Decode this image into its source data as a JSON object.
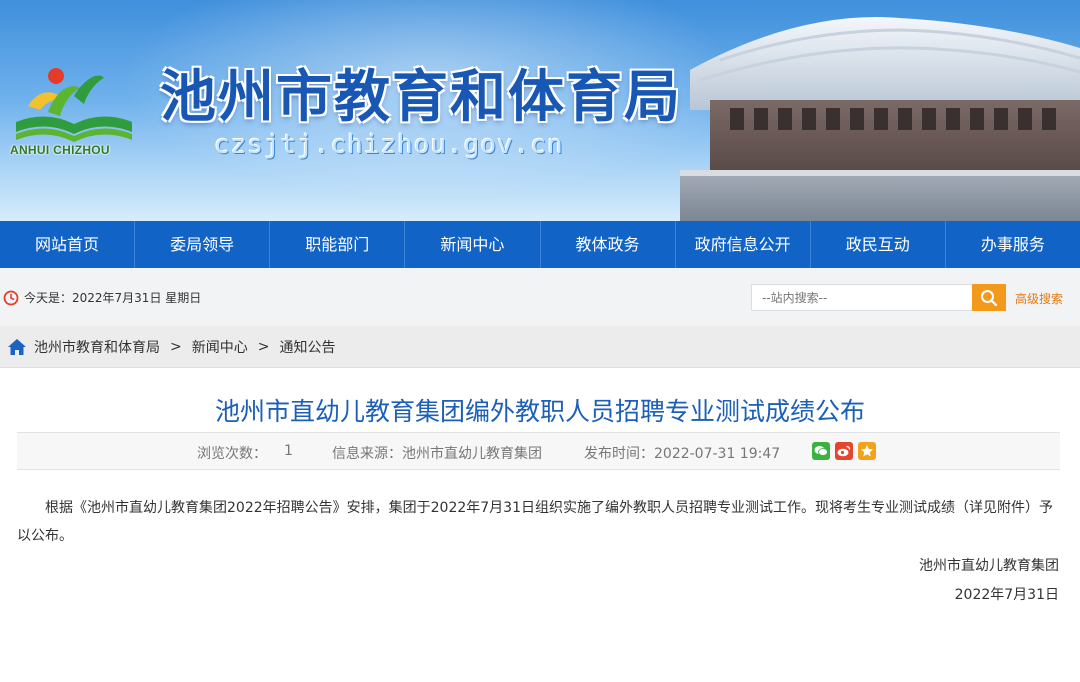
{
  "header": {
    "site_title": "池州市教育和体育局",
    "site_domain": "czsjtj.chizhou.gov.cn",
    "logo_text": "ANHUI CHIZHOU"
  },
  "nav": {
    "items": [
      "网站首页",
      "委局领导",
      "职能部门",
      "新闻中心",
      "教体政务",
      "政府信息公开",
      "政民互动",
      "办事服务"
    ]
  },
  "infobar": {
    "date_text": "今天是：2022年7月31日 星期日",
    "search_placeholder": "--站内搜索--",
    "advanced_search": "高级搜索"
  },
  "breadcrumb": {
    "items": [
      "池州市教育和体育局",
      "新闻中心",
      "通知公告"
    ],
    "separator": ">"
  },
  "article": {
    "title": "池州市直幼儿教育集团编外教职人员招聘专业测试成绩公布",
    "views_label": "浏览次数：",
    "views_value": "1",
    "source": "信息来源：池州市直幼儿教育集团",
    "publish_time": "发布时间：2022-07-31 19:47",
    "body": "根据《池州市直幼儿教育集团2022年招聘公告》安排，集团于2022年7月31日组织实施了编外教职人员招聘专业测试工作。现将考生专业测试成绩（详见附件）予以公布。",
    "sign_org": "池州市直幼儿教育集团",
    "sign_date": "2022年7月31日"
  },
  "colors": {
    "nav_bg": "#1164c6",
    "title_blue": "#1b5fb8",
    "search_orange": "#f39a1c"
  },
  "icons": [
    "clock-icon",
    "search-icon",
    "home-icon",
    "wechat-icon",
    "weibo-icon",
    "qzone-icon"
  ]
}
